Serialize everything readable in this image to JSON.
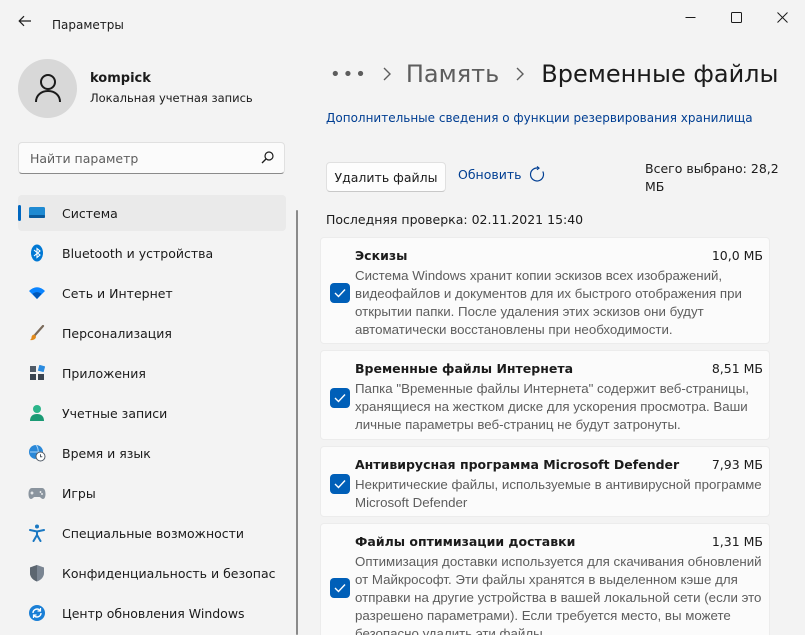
{
  "window": {
    "title": "Параметры"
  },
  "profile": {
    "name": "kompick",
    "account_type": "Локальная учетная запись"
  },
  "search": {
    "placeholder": "Найти параметр"
  },
  "nav": {
    "items": [
      {
        "label": "Система",
        "icon": "system-icon",
        "active": true
      },
      {
        "label": "Bluetooth и устройства",
        "icon": "bluetooth-icon"
      },
      {
        "label": "Сеть и Интернет",
        "icon": "wifi-icon"
      },
      {
        "label": "Персонализация",
        "icon": "brush-icon"
      },
      {
        "label": "Приложения",
        "icon": "apps-icon"
      },
      {
        "label": "Учетные записи",
        "icon": "person-icon"
      },
      {
        "label": "Время и язык",
        "icon": "globe-clock-icon"
      },
      {
        "label": "Игры",
        "icon": "gamepad-icon"
      },
      {
        "label": "Специальные возможности",
        "icon": "accessibility-icon"
      },
      {
        "label": "Конфиденциальность и безопас",
        "icon": "shield-icon"
      },
      {
        "label": "Центр обновления Windows",
        "icon": "update-icon"
      }
    ]
  },
  "breadcrumb": {
    "dots": "•••",
    "parent": "Память",
    "current": "Временные файлы"
  },
  "storage_link": "Дополнительные сведения о функции резервирования хранилища",
  "actions": {
    "delete_label": "Удалить файлы",
    "refresh_label": "Обновить"
  },
  "total_selected": "Всего выбрано: 28,2 МБ",
  "last_check": "Последняя проверка: 02.11.2021 15:40",
  "items": [
    {
      "title": "Эскизы",
      "size": "10,0 МБ",
      "checked": true,
      "description": "Система Windows хранит копии эскизов всех изображений, видеофайлов и документов для их быстрого отображения при открытии папки. После удаления этих эскизов они будут автоматически восстановлены при необходимости."
    },
    {
      "title": "Временные файлы Интернета",
      "size": "8,51 МБ",
      "checked": true,
      "description": "Папка \"Временные файлы Интернета\" содержит веб-страницы, хранящиеся на жестком диске для ускорения просмотра. Ваши личные параметры веб-страниц не будут затронуты."
    },
    {
      "title": "Антивирусная программа Microsoft Defender",
      "size": "7,93 МБ",
      "checked": true,
      "description": "Некритические файлы, используемые в антивирусной программе Microsoft Defender"
    },
    {
      "title": "Файлы оптимизации доставки",
      "size": "1,31 МБ",
      "checked": true,
      "description": "Оптимизация доставки используется для скачивания обновлений от Майкрософт. Эти файлы хранятся в выделенном кэше для отправки на другие устройства в вашей локальной сети (если это разрешено параметрами). Если требуется место, вы можете безопасно удалить эти файлы"
    }
  ],
  "colors": {
    "accent": "#005fb8",
    "link": "#003e92",
    "background": "#f3f3f3"
  }
}
